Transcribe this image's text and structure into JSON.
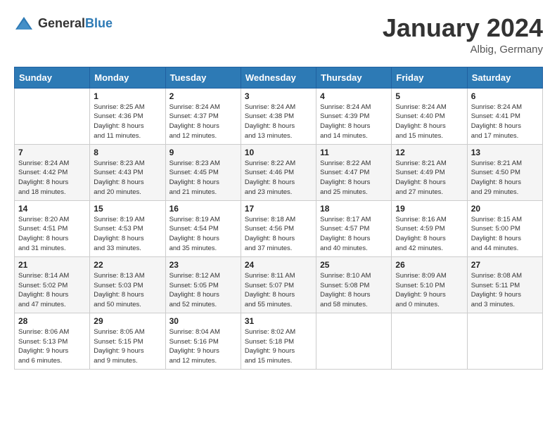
{
  "header": {
    "logo_general": "General",
    "logo_blue": "Blue",
    "month_title": "January 2024",
    "location": "Albig, Germany"
  },
  "days_of_week": [
    "Sunday",
    "Monday",
    "Tuesday",
    "Wednesday",
    "Thursday",
    "Friday",
    "Saturday"
  ],
  "weeks": [
    [
      {
        "day": "",
        "info": ""
      },
      {
        "day": "1",
        "info": "Sunrise: 8:25 AM\nSunset: 4:36 PM\nDaylight: 8 hours\nand 11 minutes."
      },
      {
        "day": "2",
        "info": "Sunrise: 8:24 AM\nSunset: 4:37 PM\nDaylight: 8 hours\nand 12 minutes."
      },
      {
        "day": "3",
        "info": "Sunrise: 8:24 AM\nSunset: 4:38 PM\nDaylight: 8 hours\nand 13 minutes."
      },
      {
        "day": "4",
        "info": "Sunrise: 8:24 AM\nSunset: 4:39 PM\nDaylight: 8 hours\nand 14 minutes."
      },
      {
        "day": "5",
        "info": "Sunrise: 8:24 AM\nSunset: 4:40 PM\nDaylight: 8 hours\nand 15 minutes."
      },
      {
        "day": "6",
        "info": "Sunrise: 8:24 AM\nSunset: 4:41 PM\nDaylight: 8 hours\nand 17 minutes."
      }
    ],
    [
      {
        "day": "7",
        "info": "Sunrise: 8:24 AM\nSunset: 4:42 PM\nDaylight: 8 hours\nand 18 minutes."
      },
      {
        "day": "8",
        "info": "Sunrise: 8:23 AM\nSunset: 4:43 PM\nDaylight: 8 hours\nand 20 minutes."
      },
      {
        "day": "9",
        "info": "Sunrise: 8:23 AM\nSunset: 4:45 PM\nDaylight: 8 hours\nand 21 minutes."
      },
      {
        "day": "10",
        "info": "Sunrise: 8:22 AM\nSunset: 4:46 PM\nDaylight: 8 hours\nand 23 minutes."
      },
      {
        "day": "11",
        "info": "Sunrise: 8:22 AM\nSunset: 4:47 PM\nDaylight: 8 hours\nand 25 minutes."
      },
      {
        "day": "12",
        "info": "Sunrise: 8:21 AM\nSunset: 4:49 PM\nDaylight: 8 hours\nand 27 minutes."
      },
      {
        "day": "13",
        "info": "Sunrise: 8:21 AM\nSunset: 4:50 PM\nDaylight: 8 hours\nand 29 minutes."
      }
    ],
    [
      {
        "day": "14",
        "info": "Sunrise: 8:20 AM\nSunset: 4:51 PM\nDaylight: 8 hours\nand 31 minutes."
      },
      {
        "day": "15",
        "info": "Sunrise: 8:19 AM\nSunset: 4:53 PM\nDaylight: 8 hours\nand 33 minutes."
      },
      {
        "day": "16",
        "info": "Sunrise: 8:19 AM\nSunset: 4:54 PM\nDaylight: 8 hours\nand 35 minutes."
      },
      {
        "day": "17",
        "info": "Sunrise: 8:18 AM\nSunset: 4:56 PM\nDaylight: 8 hours\nand 37 minutes."
      },
      {
        "day": "18",
        "info": "Sunrise: 8:17 AM\nSunset: 4:57 PM\nDaylight: 8 hours\nand 40 minutes."
      },
      {
        "day": "19",
        "info": "Sunrise: 8:16 AM\nSunset: 4:59 PM\nDaylight: 8 hours\nand 42 minutes."
      },
      {
        "day": "20",
        "info": "Sunrise: 8:15 AM\nSunset: 5:00 PM\nDaylight: 8 hours\nand 44 minutes."
      }
    ],
    [
      {
        "day": "21",
        "info": "Sunrise: 8:14 AM\nSunset: 5:02 PM\nDaylight: 8 hours\nand 47 minutes."
      },
      {
        "day": "22",
        "info": "Sunrise: 8:13 AM\nSunset: 5:03 PM\nDaylight: 8 hours\nand 50 minutes."
      },
      {
        "day": "23",
        "info": "Sunrise: 8:12 AM\nSunset: 5:05 PM\nDaylight: 8 hours\nand 52 minutes."
      },
      {
        "day": "24",
        "info": "Sunrise: 8:11 AM\nSunset: 5:07 PM\nDaylight: 8 hours\nand 55 minutes."
      },
      {
        "day": "25",
        "info": "Sunrise: 8:10 AM\nSunset: 5:08 PM\nDaylight: 8 hours\nand 58 minutes."
      },
      {
        "day": "26",
        "info": "Sunrise: 8:09 AM\nSunset: 5:10 PM\nDaylight: 9 hours\nand 0 minutes."
      },
      {
        "day": "27",
        "info": "Sunrise: 8:08 AM\nSunset: 5:11 PM\nDaylight: 9 hours\nand 3 minutes."
      }
    ],
    [
      {
        "day": "28",
        "info": "Sunrise: 8:06 AM\nSunset: 5:13 PM\nDaylight: 9 hours\nand 6 minutes."
      },
      {
        "day": "29",
        "info": "Sunrise: 8:05 AM\nSunset: 5:15 PM\nDaylight: 9 hours\nand 9 minutes."
      },
      {
        "day": "30",
        "info": "Sunrise: 8:04 AM\nSunset: 5:16 PM\nDaylight: 9 hours\nand 12 minutes."
      },
      {
        "day": "31",
        "info": "Sunrise: 8:02 AM\nSunset: 5:18 PM\nDaylight: 9 hours\nand 15 minutes."
      },
      {
        "day": "",
        "info": ""
      },
      {
        "day": "",
        "info": ""
      },
      {
        "day": "",
        "info": ""
      }
    ]
  ]
}
